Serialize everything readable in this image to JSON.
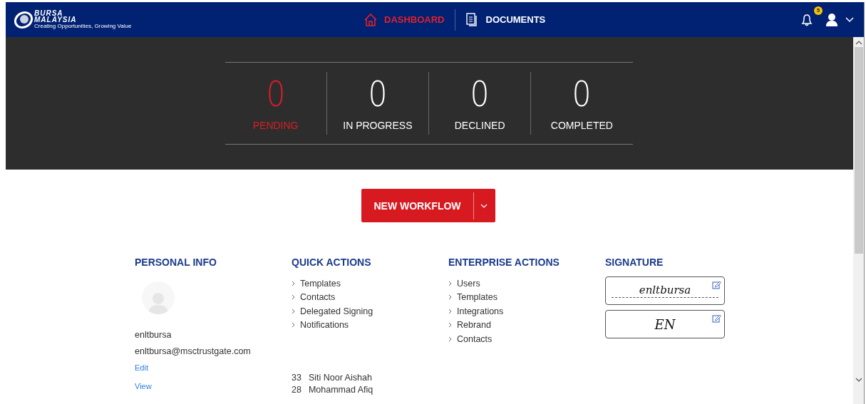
{
  "header": {
    "logo": {
      "name": "BURSA",
      "name2": "MALAYSIA",
      "tagline": "Creating Opportunities, Growing Value"
    },
    "nav": [
      {
        "label": "DASHBOARD",
        "kind": "home",
        "selected": true
      },
      {
        "label": "DOCUMENTS",
        "kind": "documents",
        "selected": false
      }
    ],
    "notifications": {
      "count": "5"
    }
  },
  "stats": [
    {
      "value": "0",
      "label": "PENDING",
      "highlighted": true
    },
    {
      "value": "0",
      "label": "IN PROGRESS",
      "highlighted": false
    },
    {
      "value": "0",
      "label": "DECLINED",
      "highlighted": false
    },
    {
      "value": "0",
      "label": "COMPLETED",
      "highlighted": false
    }
  ],
  "new_workflow_button": {
    "label": "NEW WORKFLOW"
  },
  "personal_info": {
    "title": "PERSONAL INFO",
    "username": "enltbursa",
    "email": "enltbursa@msctrustgate.com",
    "links": [
      "Edit",
      "View"
    ]
  },
  "quick_actions": {
    "title": "QUICK ACTIONS",
    "items": [
      "Templates",
      "Contacts",
      "Delegated Signing",
      "Notifications"
    ],
    "list": [
      {
        "count": "33",
        "name": "Siti Noor Aishah"
      },
      {
        "count": "28",
        "name": "Mohammad Afiq"
      }
    ]
  },
  "enterprise_actions": {
    "title": "ENTERPRISE ACTIONS",
    "items": [
      "Users",
      "Templates",
      "Integrations",
      "Rebrand",
      "Contacts"
    ]
  },
  "signature": {
    "title": "SIGNATURE",
    "items": [
      {
        "text": "enltbursa",
        "kind": "signature"
      },
      {
        "text": "EN",
        "kind": "initials"
      }
    ]
  }
}
